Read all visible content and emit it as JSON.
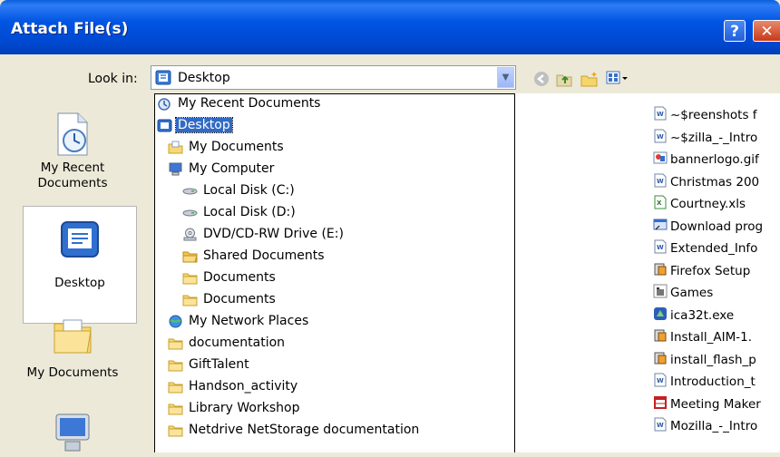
{
  "window": {
    "title": "Attach File(s)",
    "help_glyph": "?",
    "close_glyph": "✕"
  },
  "lookin": {
    "label": "Look in:",
    "value": "Desktop"
  },
  "places": [
    {
      "label": "My Recent Documents"
    },
    {
      "label": "Desktop"
    },
    {
      "label": "My Documents"
    }
  ],
  "dropdown": {
    "items": [
      {
        "label": "My Recent Documents",
        "icon": "recent-documents-icon",
        "indent": 0
      },
      {
        "label": "Desktop",
        "icon": "desktop-icon",
        "indent": 0,
        "selected": true
      },
      {
        "label": "My Documents",
        "icon": "my-documents-icon",
        "indent": 1
      },
      {
        "label": "My Computer",
        "icon": "my-computer-icon",
        "indent": 1
      },
      {
        "label": "Local Disk (C:)",
        "icon": "hard-disk-icon",
        "indent": 2
      },
      {
        "label": "Local Disk (D:)",
        "icon": "hard-disk-icon",
        "indent": 2
      },
      {
        "label": "DVD/CD-RW Drive (E:)",
        "icon": "cd-drive-icon",
        "indent": 2
      },
      {
        "label": "Shared Documents",
        "icon": "shared-folder-icon",
        "indent": 2
      },
      {
        "label": "Documents",
        "icon": "folder-icon",
        "indent": 2
      },
      {
        "label": "Documents",
        "icon": "folder-icon",
        "indent": 2
      },
      {
        "label": "My Network Places",
        "icon": "network-places-icon",
        "indent": 1
      },
      {
        "label": "documentation",
        "icon": "folder-icon",
        "indent": 1
      },
      {
        "label": "GiftTalent",
        "icon": "folder-icon",
        "indent": 1
      },
      {
        "label": "Handson_activity",
        "icon": "folder-icon",
        "indent": 1
      },
      {
        "label": "Library Workshop",
        "icon": "folder-icon",
        "indent": 1
      },
      {
        "label": "Netdrive NetStorage documentation",
        "icon": "folder-icon",
        "indent": 1
      }
    ]
  },
  "files": [
    {
      "name": "~$reenshots f",
      "icon": "word-doc-icon"
    },
    {
      "name": "~$zilla_-_Intro",
      "icon": "word-doc-icon"
    },
    {
      "name": "bannerlogo.gif",
      "icon": "image-icon"
    },
    {
      "name": "Christmas 200",
      "icon": "word-doc-icon"
    },
    {
      "name": "Courtney.xls",
      "icon": "excel-icon"
    },
    {
      "name": "Download prog",
      "icon": "shortcut-icon"
    },
    {
      "name": "Extended_Info",
      "icon": "word-doc-icon"
    },
    {
      "name": "Firefox Setup",
      "icon": "installer-icon"
    },
    {
      "name": "Games",
      "icon": "games-shortcut-icon"
    },
    {
      "name": "ica32t.exe",
      "icon": "exe-icon"
    },
    {
      "name": "Install_AIM-1.",
      "icon": "installer-icon"
    },
    {
      "name": "install_flash_p",
      "icon": "installer-icon"
    },
    {
      "name": "Introduction_t",
      "icon": "word-doc-icon"
    },
    {
      "name": "Meeting Maker",
      "icon": "app-icon"
    },
    {
      "name": "Mozilla_-_Intro",
      "icon": "word-doc-icon"
    }
  ],
  "colors": {
    "titlebar": "#0054E3",
    "selection": "#316AC5",
    "dialog_bg": "#ECE9D8"
  }
}
